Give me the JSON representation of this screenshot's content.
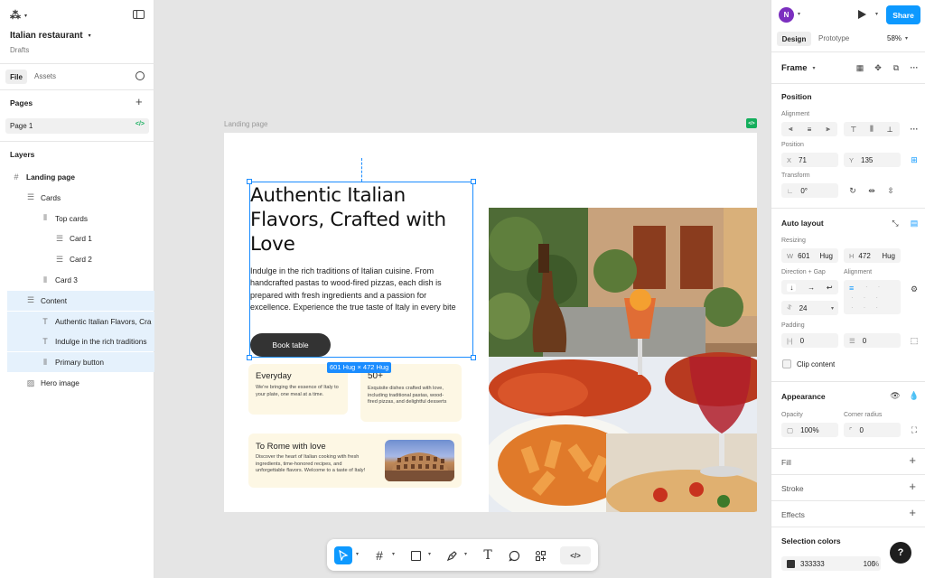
{
  "left": {
    "file_name": "Italian restaurant",
    "location": "Drafts",
    "tabs": [
      "File",
      "Assets"
    ],
    "pages_heading": "Pages",
    "page_item": "Page 1",
    "layers_heading": "Layers",
    "layers": [
      {
        "label": "Landing page",
        "indent": 0,
        "icon": "grid-icon",
        "bold": true
      },
      {
        "label": "Cards",
        "indent": 1,
        "icon": "auto-layout-icon"
      },
      {
        "label": "Top cards",
        "indent": 2,
        "icon": "auto-layout-h-icon"
      },
      {
        "label": "Card 1",
        "indent": 3,
        "icon": "auto-layout-icon"
      },
      {
        "label": "Card 2",
        "indent": 3,
        "icon": "auto-layout-icon"
      },
      {
        "label": "Card 3",
        "indent": 2,
        "icon": "auto-layout-h-icon"
      },
      {
        "label": "Content",
        "indent": 1,
        "icon": "auto-layout-icon",
        "selected": true
      },
      {
        "label": "Authentic Italian Flavors, Cra",
        "indent": 2,
        "icon": "text-icon",
        "selected": true
      },
      {
        "label": "Indulge in the rich traditions",
        "indent": 2,
        "icon": "text-icon",
        "selected": true
      },
      {
        "label": "Primary button",
        "indent": 2,
        "icon": "auto-layout-h-icon",
        "selected": true
      },
      {
        "label": "Hero image",
        "indent": 1,
        "icon": "image-icon"
      }
    ]
  },
  "canvas": {
    "frame_label": "Landing page",
    "heading": "Authentic Italian Flavors, Crafted with Love",
    "body": "Indulge in the rich traditions of Italian cuisine. From handcrafted pastas to wood-fired pizzas, each dish is prepared with fresh ingredients and a passion for excellence. Experience the true taste of Italy in every bite",
    "button": "Book table",
    "size_badge": "601 Hug × 472 Hug",
    "cards": [
      {
        "title": "Everyday",
        "desc": "We're bringing the essence of Italy to your plate, one meal at a time."
      },
      {
        "title": "50+",
        "desc": "Exquisite dishes crafted with love, including traditional pastas, wood-fired pizzas, and delightful desserts"
      },
      {
        "title": "To Rome with love",
        "desc": "Discover the heart of Italian cooking with fresh ingredients, time-honored recipes, and unforgettable flavors. Welcome to a taste of Italy!"
      }
    ]
  },
  "toolbar": {
    "icons": [
      "move-icon",
      "frame-icon",
      "rectangle-icon",
      "pen-icon",
      "text-icon",
      "comment-icon",
      "actions-icon",
      "dev-mode-icon"
    ]
  },
  "right": {
    "avatar": "N",
    "share": "Share",
    "tabs": [
      "Design",
      "Prototype"
    ],
    "zoom": "58%",
    "frame_dropdown": "Frame",
    "position_heading": "Position",
    "alignment_label": "Alignment",
    "position_label": "Position",
    "x_prefix": "X",
    "x": "71",
    "y_prefix": "Y",
    "y": "135",
    "transform_label": "Transform",
    "rotation": "0°",
    "auto_layout_heading": "Auto layout",
    "resizing_label": "Resizing",
    "w_prefix": "W",
    "w": "601",
    "w_mode": "Hug",
    "h_prefix": "H",
    "h": "472",
    "h_mode": "Hug",
    "direction_label": "Direction + Gap",
    "alignment2_label": "Alignment",
    "gap": "24",
    "padding_label": "Padding",
    "pad_h": "0",
    "pad_v": "0",
    "clip_content": "Clip content",
    "appearance_heading": "Appearance",
    "opacity_label": "Opacity",
    "corner_label": "Corner radius",
    "opacity": "100%",
    "corner": "0",
    "fill": "Fill",
    "stroke": "Stroke",
    "effects": "Effects",
    "selection_colors": "Selection colors",
    "color_hex": "333333",
    "color_opacity": "100",
    "percent": "%",
    "help": "?"
  },
  "colors": {
    "accent": "#0d99ff",
    "selection_blue": "#1a8cff",
    "button_dark": "#333333",
    "card_bg": "#fdf7e4",
    "dev_green": "#14ae5c"
  }
}
